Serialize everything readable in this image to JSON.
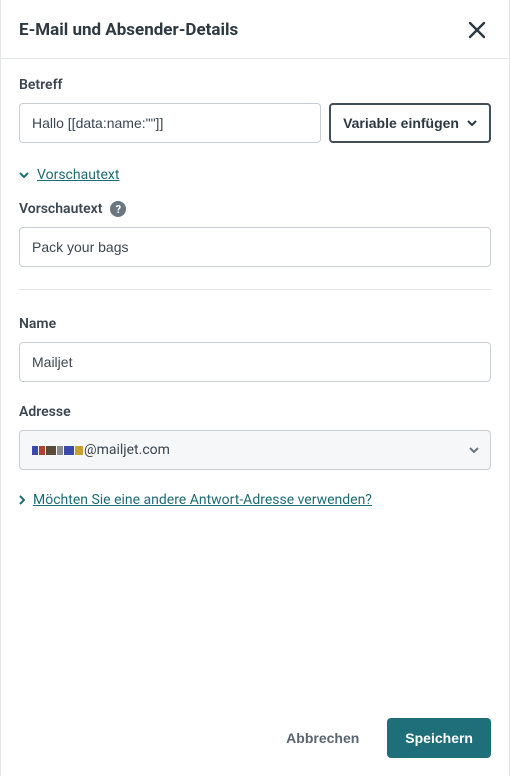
{
  "header": {
    "title": "E-Mail und Absender-Details"
  },
  "subject": {
    "label": "Betreff",
    "value": "Hallo [[data:name:\"\"]]",
    "insert_var_label": "Variable einfügen"
  },
  "preview_toggle": {
    "label": "Vorschautext"
  },
  "preview_text": {
    "label": "Vorschautext",
    "value": "Pack your bags"
  },
  "name": {
    "label": "Name",
    "value": "Mailjet"
  },
  "address": {
    "label": "Adresse",
    "domain": "@mailjet.com"
  },
  "reply_to_toggle": {
    "label": "Möchten Sie eine andere Antwort-Adresse verwenden?"
  },
  "footer": {
    "cancel": "Abbrechen",
    "save": "Speichern"
  }
}
